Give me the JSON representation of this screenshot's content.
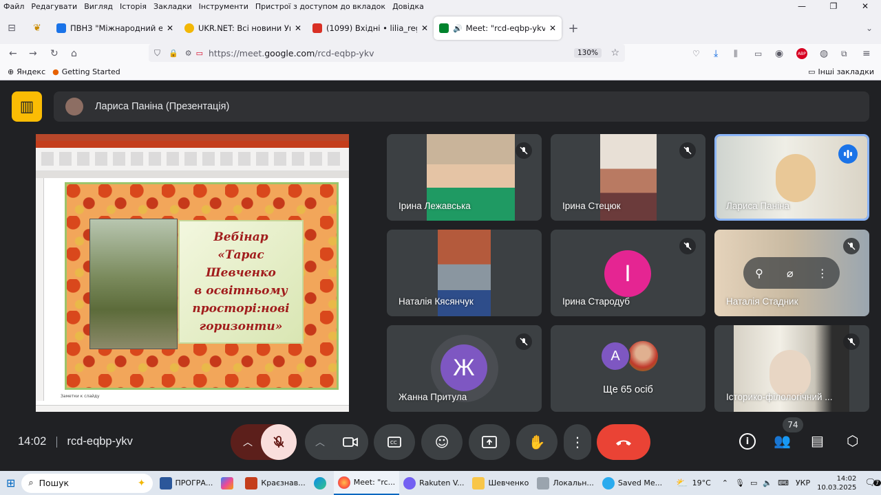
{
  "menu": [
    "Файл",
    "Редагувати",
    "Вигляд",
    "Історія",
    "Закладки",
    "Інструменти",
    "Пристрої з доступом до вкладок",
    "Довідка"
  ],
  "tabs": [
    {
      "label": "ПВНЗ \"Міжнародний економі",
      "color": "#1a73e8"
    },
    {
      "label": "UKR.NET: Всі новини України, о",
      "color": "#f2b705"
    },
    {
      "label": "(1099) Вхідні • lilia_regi@ukr.ne",
      "color": "#d93025"
    },
    {
      "label": "Meet: \"rcd-eqbp-ykv\"",
      "color": "#00832d"
    }
  ],
  "url": {
    "prefix": "https://meet.",
    "domain": "google.com",
    "path": "/rcd-eqbp-ykv",
    "zoom": "130%"
  },
  "bookmarks": {
    "yandex": "Яндекс",
    "getting_started": "Getting Started",
    "other": "Інші закладки"
  },
  "presenter": {
    "name": "Лариса Паніна (Презентація)"
  },
  "slide": {
    "title": "Вебінар «Тарас Шевченко в освітньому просторі:нові горизонти»",
    "lines": [
      "Вебінар",
      "«Тарас",
      "Шевченко",
      "в освітньому",
      "просторі:нові",
      "горизонти»"
    ],
    "notes": "Заметки к слайду"
  },
  "participants": [
    {
      "name": "Ірина Лежавська",
      "muted": true
    },
    {
      "name": "Ірина Стецюк",
      "muted": true
    },
    {
      "name": "Лариса Паніна",
      "muted": false,
      "speaking": true
    },
    {
      "name": "Наталія Кясянчук",
      "muted": false
    },
    {
      "name": "Ірина Стародуб",
      "muted": true,
      "initial": "І",
      "avatar_color": "#e52592"
    },
    {
      "name": "Наталія Стадник",
      "muted": true
    },
    {
      "name": "Жанна Притула",
      "muted": true,
      "initial": "Ж",
      "avatar_color": "#7e57c2"
    },
    {
      "name": "Ще 65 осіб",
      "initial": "А",
      "avatar_color": "#7e57c2"
    },
    {
      "name": "Історико-філологічний ...",
      "muted": true
    }
  ],
  "bottom": {
    "time": "14:02",
    "meeting_code": "rcd-eqbp-ykv",
    "participants_count": "74"
  },
  "taskbar": {
    "search": "Пошук",
    "items": [
      "ПРОГРА...",
      "Краєзнав...",
      "Meet: \"rc...",
      "Rakuten V...",
      "Шевченко",
      "Локальн...",
      "Saved Me..."
    ],
    "weather": "19°C",
    "lang": "УКР",
    "clock_time": "14:02",
    "clock_date": "10.03.2025",
    "notif": "7"
  }
}
